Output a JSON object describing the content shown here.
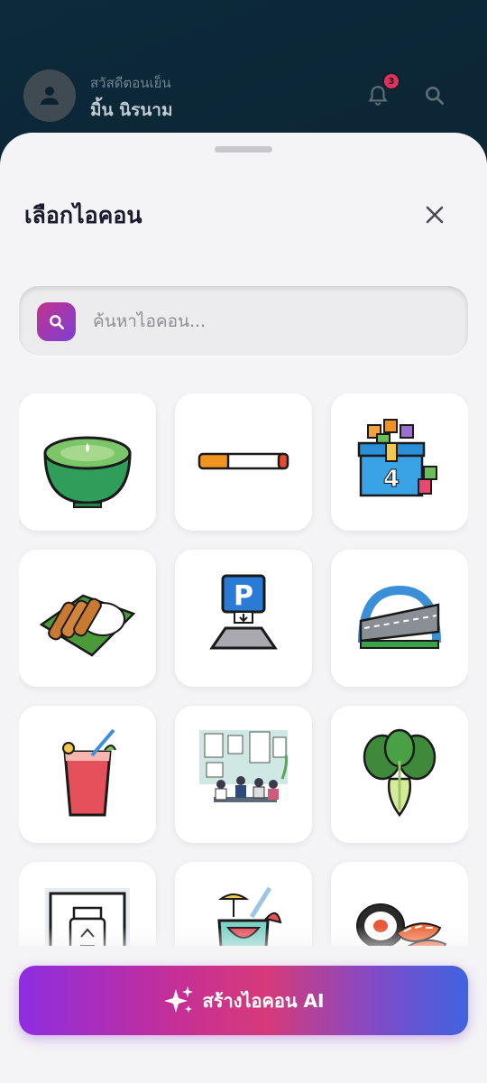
{
  "header": {
    "greeting": "สวัสดีตอนเย็น",
    "user_name": "มิ้น นิรนาม",
    "notification_count": "3"
  },
  "sheet": {
    "title": "เลือกไอคอน"
  },
  "search": {
    "placeholder": "ค้นหาไอคอน..."
  },
  "icons": [
    {
      "icon": "green-tea-soup-icon"
    },
    {
      "icon": "cigarette-icon"
    },
    {
      "icon": "boxes-number-4-icon"
    },
    {
      "icon": "fried-chicken-rice-icon"
    },
    {
      "icon": "parking-sign-icon"
    },
    {
      "icon": "bridge-road-icon"
    },
    {
      "icon": "watermelon-juice-icon"
    },
    {
      "icon": "office-team-meeting-icon"
    },
    {
      "icon": "bok-choy-icon"
    },
    {
      "icon": "recycle-bottle-icon"
    },
    {
      "icon": "watermelon-drink-icon"
    },
    {
      "icon": "sushi-roll-icon"
    }
  ],
  "ai_button": {
    "label": "สร้างไอคอน AI"
  },
  "colors": {
    "accent_gradient_start": "#8e2de2",
    "accent_gradient_end": "#3f63e0",
    "badge": "#e0315e"
  }
}
